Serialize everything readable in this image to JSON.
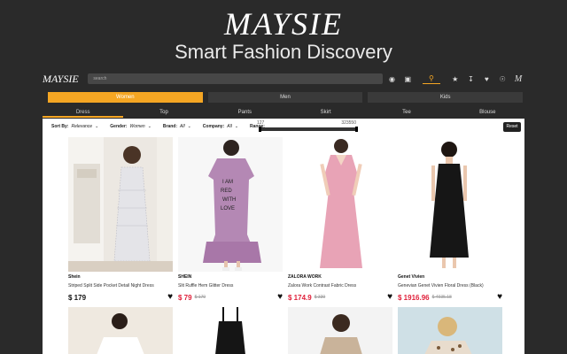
{
  "hero": {
    "logo": "MAYSIE",
    "subtitle": "Smart Fashion Discovery"
  },
  "topbar": {
    "logo": "MAYSIE",
    "search_placeholder": "search",
    "icons": [
      "palette-icon",
      "camera-icon",
      "search-icon",
      "star-icon",
      "download-icon",
      "heart-icon",
      "globe-icon",
      "maysie-icon"
    ]
  },
  "gender_tabs": [
    {
      "label": "Women",
      "active": true
    },
    {
      "label": "Men",
      "active": false
    },
    {
      "label": "Kids",
      "active": false
    }
  ],
  "categories": [
    {
      "label": "Dress",
      "active": true
    },
    {
      "label": "Top",
      "active": false
    },
    {
      "label": "Pants",
      "active": false
    },
    {
      "label": "Skirt",
      "active": false
    },
    {
      "label": "Tee",
      "active": false
    },
    {
      "label": "Blouse",
      "active": false
    }
  ],
  "filters": {
    "sort": {
      "label": "Sort By:",
      "value": "Relevance"
    },
    "gender": {
      "label": "Gender:",
      "value": "Women"
    },
    "brand": {
      "label": "Brand:",
      "value": "All"
    },
    "company": {
      "label": "Company:",
      "value": "All"
    },
    "range": {
      "label": "Range:",
      "min": "127",
      "max": "323550",
      "fill_fraction": 1.0
    },
    "reset": "Reset"
  },
  "products": [
    {
      "brand": "Shein",
      "name": "Striped Split Side Pocket Detail Night Dress",
      "price": "$ 179",
      "old_price": "",
      "sale": false
    },
    {
      "brand": "SHEIN",
      "name": "Slit Ruffle Hem Glitter Dress",
      "price": "$ 79",
      "old_price": "$ 179",
      "sale": true
    },
    {
      "brand": "ZALORA WORK",
      "name": "Zalora Work Contrast Fabric Dress",
      "price": "$ 174.9",
      "old_price": "$ 339",
      "sale": true
    },
    {
      "brand": "Genet Vivien",
      "name": "Genevian Genet Vivien Floral Dress (Black)",
      "price": "$ 1916.96",
      "old_price": "$ 4935.18",
      "sale": true
    }
  ],
  "colors": {
    "accent": "#f5a623",
    "sale": "#e0203a",
    "background": "#2a2a2a"
  }
}
